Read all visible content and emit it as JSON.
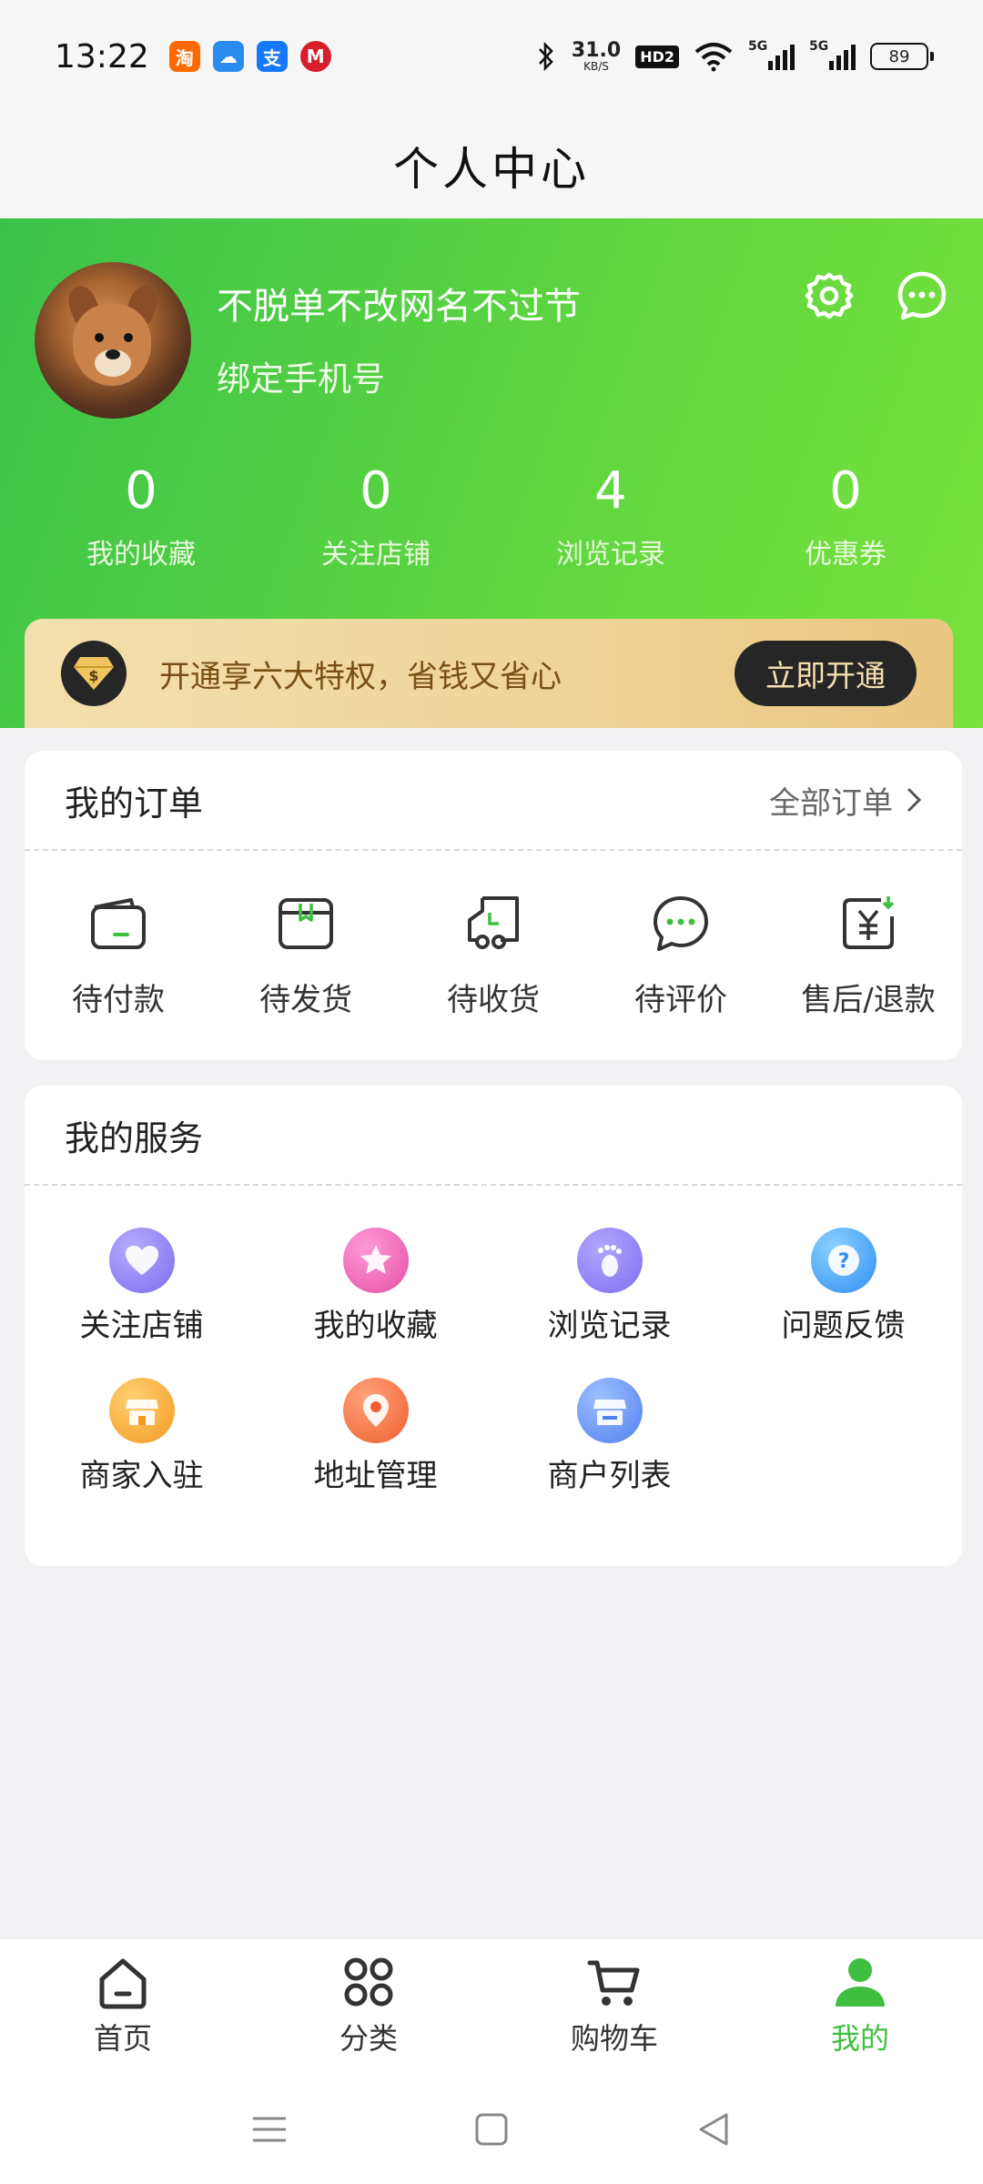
{
  "status_bar": {
    "time": "13:22",
    "app_icons": [
      {
        "name": "taobao-icon",
        "glyph": "淘",
        "color": "#ff6a00"
      },
      {
        "name": "cloud-app-icon",
        "glyph": "☁",
        "color": "#2a8cf0"
      },
      {
        "name": "alipay-icon",
        "glyph": "支",
        "color": "#1677ff"
      },
      {
        "name": "cmb-bank-icon",
        "glyph": "M",
        "color": "#d81e2b"
      }
    ],
    "net_speed_value": "31.0",
    "net_speed_unit": "KB/S",
    "hd_badge": "HD2",
    "signal_label_1": "5G",
    "signal_label_2": "5G",
    "battery": "89"
  },
  "header": {
    "title": "个人中心"
  },
  "profile": {
    "username": "不脱单不改网名不过节",
    "bind_phone": "绑定手机号",
    "stats": [
      {
        "value": "0",
        "label": "我的收藏"
      },
      {
        "value": "0",
        "label": "关注店铺"
      },
      {
        "value": "4",
        "label": "浏览记录"
      },
      {
        "value": "0",
        "label": "优惠券"
      }
    ]
  },
  "vip": {
    "text": "开通享六大特权，省钱又省心",
    "button": "立即开通"
  },
  "orders": {
    "title": "我的订单",
    "all_link": "全部订单",
    "items": [
      {
        "label": "待付款",
        "icon": "wallet-icon"
      },
      {
        "label": "待发货",
        "icon": "package-icon"
      },
      {
        "label": "待收货",
        "icon": "truck-icon"
      },
      {
        "label": "待评价",
        "icon": "chat-bubble-icon"
      },
      {
        "label": "售后/退款",
        "icon": "refund-icon"
      }
    ]
  },
  "services": {
    "title": "我的服务",
    "items": [
      {
        "label": "关注店铺",
        "icon": "heart-icon",
        "color": "#8a7cf0"
      },
      {
        "label": "我的收藏",
        "icon": "star-icon",
        "color": "#ee5fb0"
      },
      {
        "label": "浏览记录",
        "icon": "footprint-icon",
        "color": "#8b7cf0"
      },
      {
        "label": "问题反馈",
        "icon": "question-icon",
        "color": "#3a9cf5"
      },
      {
        "label": "商家入驻",
        "icon": "store-icon",
        "color": "#f7a531"
      },
      {
        "label": "地址管理",
        "icon": "location-pin-icon",
        "color": "#f3723a"
      },
      {
        "label": "商户列表",
        "icon": "shop-list-icon",
        "color": "#5b8cf0"
      }
    ]
  },
  "bottom_nav": {
    "items": [
      {
        "label": "首页",
        "icon": "home-icon"
      },
      {
        "label": "分类",
        "icon": "category-icon"
      },
      {
        "label": "购物车",
        "icon": "cart-icon"
      },
      {
        "label": "我的",
        "icon": "user-icon",
        "active": true
      }
    ],
    "active_color": "#3fbf3f"
  },
  "theme": {
    "green_start": "#3cc24a",
    "green_end": "#79e23c",
    "vip_gold": "#efd49a"
  }
}
